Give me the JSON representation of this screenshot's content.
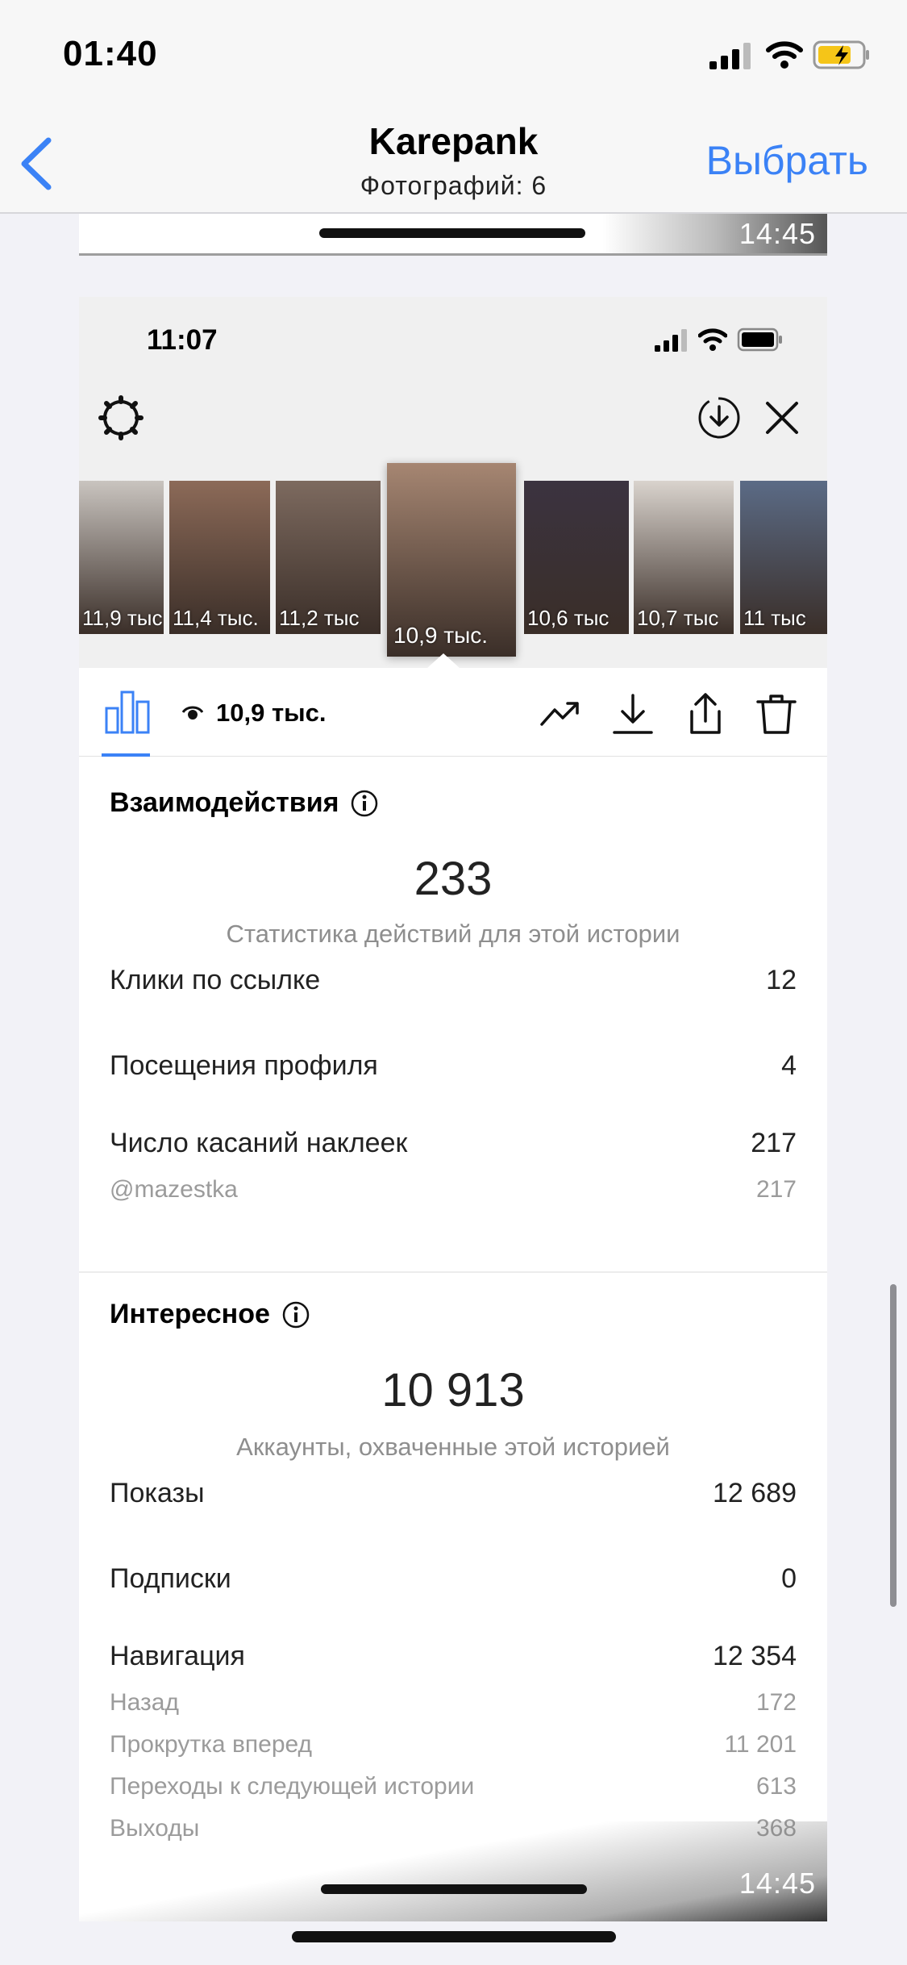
{
  "os_status": {
    "time": "01:40"
  },
  "nav": {
    "title": "Karepank",
    "subtitle": "Фотографий: 6",
    "select_label": "Выбрать"
  },
  "prev_photo": {
    "time": "14:45"
  },
  "screenshot": {
    "status_time": "11:07",
    "thumbnails": [
      {
        "views": "11,9 тыс",
        "bg": "#c9c4bf"
      },
      {
        "views": "11,4 тыс.",
        "bg": "#8c6a58"
      },
      {
        "views": "11,2 тыс",
        "bg": "#7d6a5f"
      },
      {
        "views": "10,9 тыс.",
        "bg": "#a68672"
      },
      {
        "views": "10,6 тыс",
        "bg": "#3b3340"
      },
      {
        "views": "10,7 тыс",
        "bg": "#d9d3cd"
      },
      {
        "views": "11 тыс",
        "bg": "#5b6b86"
      }
    ],
    "toolbar": {
      "views": "10,9 тыс."
    },
    "interactions": {
      "title": "Взаимодействия",
      "total": "233",
      "caption": "Статистика действий для этой истории",
      "rows": [
        {
          "label": "Клики по ссылке",
          "value": "12"
        },
        {
          "label": "Посещения профиля",
          "value": "4"
        },
        {
          "label": "Число касаний наклеек",
          "value": "217"
        }
      ],
      "sub_rows": [
        {
          "label": "@mazestka",
          "value": "217"
        }
      ]
    },
    "discovery": {
      "title": "Интересное",
      "total": "10 913",
      "caption": "Аккаунты, охваченные этой историей",
      "rows": [
        {
          "label": "Показы",
          "value": "12 689"
        },
        {
          "label": "Подписки",
          "value": "0"
        },
        {
          "label": "Навигация",
          "value": "12 354"
        }
      ],
      "sub_rows": [
        {
          "label": "Назад",
          "value": "172"
        },
        {
          "label": "Прокрутка вперед",
          "value": "11 201"
        },
        {
          "label": "Переходы к следующей истории",
          "value": "613"
        },
        {
          "label": "Выходы",
          "value": "368"
        }
      ]
    },
    "time_overlay": "14:45"
  },
  "colors": {
    "accent": "#3b82f6",
    "battery": "#f5c518"
  }
}
